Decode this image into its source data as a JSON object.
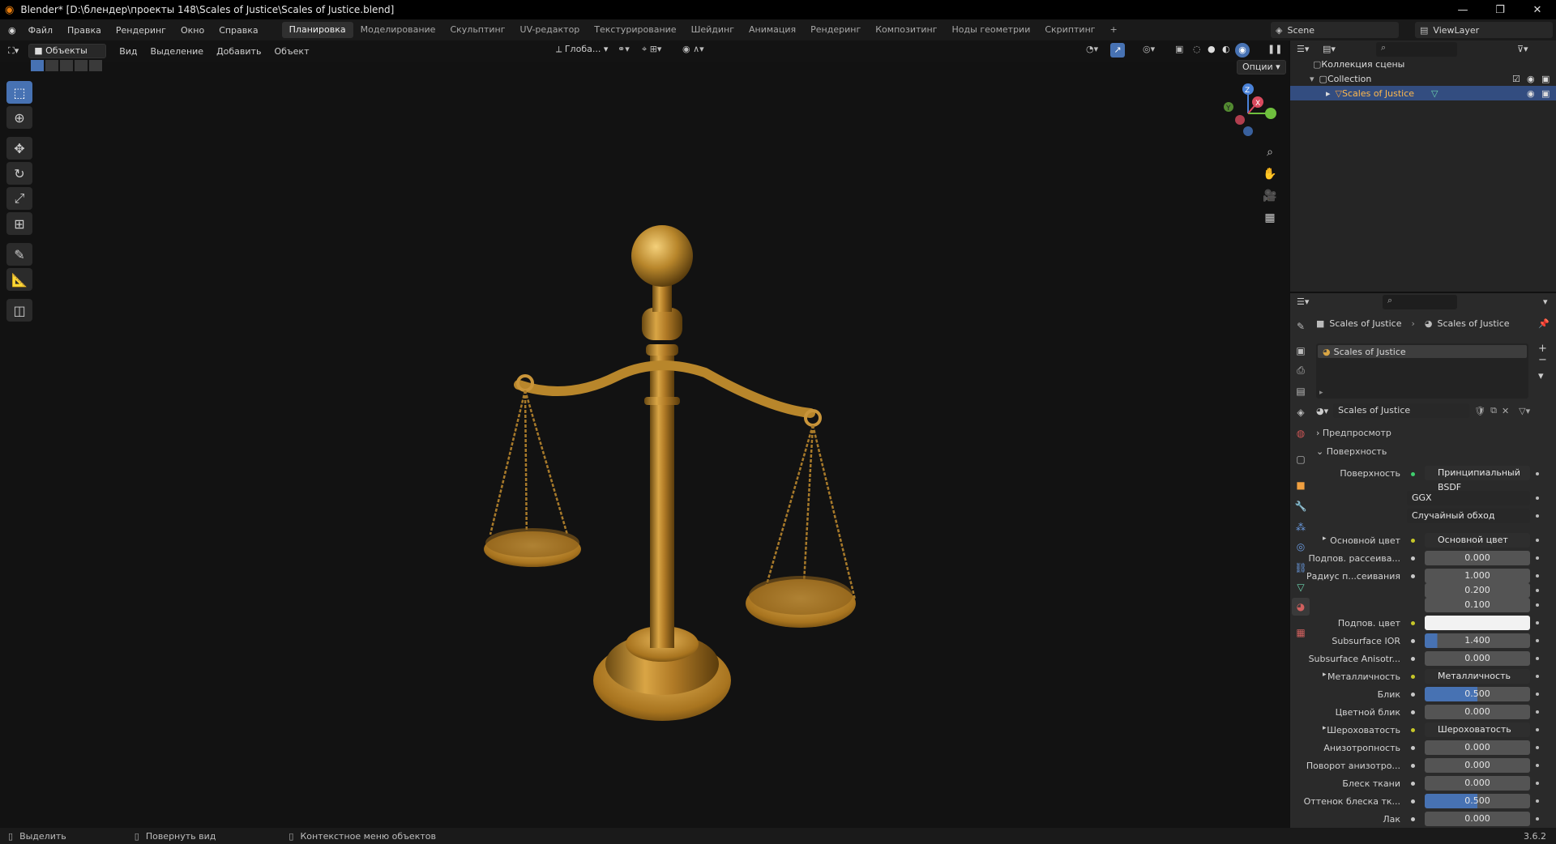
{
  "window": {
    "title": "Blender* [D:\\блендер\\проекты 148\\Scales of Justice\\Scales of Justice.blend]",
    "minimize": "—",
    "maximize": "❐",
    "close": "✕"
  },
  "menu": [
    "Файл",
    "Правка",
    "Рендеринг",
    "Окно",
    "Справка"
  ],
  "workspaces": [
    "Планировка",
    "Моделирование",
    "Скульптинг",
    "UV-редактор",
    "Текстурирование",
    "Шейдинг",
    "Анимация",
    "Рендеринг",
    "Композитинг",
    "Ноды геометрии",
    "Скриптинг",
    "+"
  ],
  "scene": {
    "name": "Scene",
    "view_layer": "ViewLayer"
  },
  "viewport_header": {
    "mode": "Объекты",
    "menus": [
      "Вид",
      "Выделение",
      "Добавить",
      "Объект"
    ],
    "transform_orientation": "Глоба...",
    "options": "Опции"
  },
  "tools": [
    "select",
    "cursor",
    "move",
    "rotate",
    "scale",
    "transform",
    "annotate",
    "measure",
    "add-cube"
  ],
  "outliner": {
    "root": "Коллекция сцены",
    "collection": "Collection",
    "object": "Scales of Justice"
  },
  "properties": {
    "breadcrumb": [
      "Scales of Justice",
      "Scales of Justice"
    ],
    "material_slot": "Scales of Justice",
    "material_name": "Scales of Justice",
    "panels": {
      "preview": "Предпросмотр",
      "surface": "Поверхность"
    },
    "surface_label": "Поверхность",
    "surface_value": "Принципиальный BSDF",
    "distribution": "GGX",
    "subsurface_method": "Случайный обход",
    "rows": [
      {
        "label": "Основной цвет",
        "value": "Основной цвет",
        "kind": "link"
      },
      {
        "label": "Подпов. рассеива...",
        "value": "0.000",
        "kind": "num"
      },
      {
        "label": "Радиус п...сеивания",
        "value": "1.000",
        "kind": "num"
      },
      {
        "label": "",
        "value": "0.200",
        "kind": "num"
      },
      {
        "label": "",
        "value": "0.100",
        "kind": "num"
      },
      {
        "label": "Подпов. цвет",
        "value": "",
        "kind": "color"
      },
      {
        "label": "Subsurface IOR",
        "value": "1.400",
        "kind": "num"
      },
      {
        "label": "Subsurface Anisotr...",
        "value": "0.000",
        "kind": "num"
      },
      {
        "label": "Металличность",
        "value": "Металличность",
        "kind": "link"
      },
      {
        "label": "Блик",
        "value": "0.500",
        "kind": "num"
      },
      {
        "label": "Цветной блик",
        "value": "0.000",
        "kind": "num"
      },
      {
        "label": "Шероховатость",
        "value": "Шероховатость",
        "kind": "link"
      },
      {
        "label": "Анизотропность",
        "value": "0.000",
        "kind": "num"
      },
      {
        "label": "Поворот анизотро...",
        "value": "0.000",
        "kind": "num"
      },
      {
        "label": "Блеск ткани",
        "value": "0.000",
        "kind": "num"
      },
      {
        "label": "Оттенок блеска тк...",
        "value": "0.500",
        "kind": "num"
      },
      {
        "label": "Лак",
        "value": "0.000",
        "kind": "num"
      }
    ]
  },
  "statusbar": {
    "select": "Выделить",
    "rotate": "Повернуть вид",
    "context": "Контекстное меню объектов",
    "version": "3.6.2"
  },
  "colors": {
    "accent": "#4772b3",
    "gold": "#b8862b",
    "viewport_bg": "#121212",
    "panel_bg": "#2a2a2a"
  }
}
